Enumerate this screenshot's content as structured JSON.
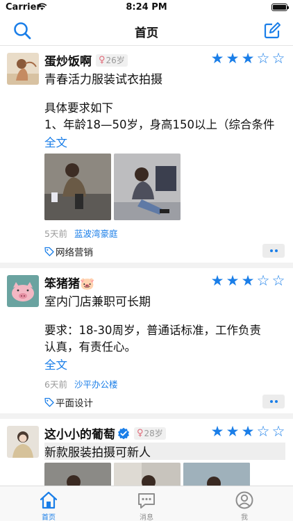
{
  "status_bar": {
    "carrier": "Carrier",
    "time": "8:24 PM"
  },
  "nav": {
    "title": "首页"
  },
  "posts": [
    {
      "username": "蛋炒饭啊",
      "age": "26岁",
      "rating": 3,
      "max_rating": 5,
      "title": "青春活力服装试衣拍摄",
      "body": "具体要求如下\n1、年龄18—50岁，身高150以上（综合条件",
      "more_text": "全文",
      "time": "5天前",
      "place": "蓝波湾豪庭",
      "tag": "网络营销"
    },
    {
      "username": "笨猪猪🐷",
      "rating": 3,
      "max_rating": 5,
      "title": "室内门店兼职可长期",
      "body": "要求：18-30周岁，普通话标准，工作负责\n认真，有责任心。",
      "more_text": "全文",
      "time": "6天前",
      "place": "沙平办公楼",
      "tag": "平面设计"
    },
    {
      "username": "这小小的葡萄",
      "age": "28岁",
      "rating": 3,
      "max_rating": 5,
      "title": "新款服装拍摄可新人"
    }
  ],
  "tabs": [
    {
      "label": "首页",
      "icon": "home-icon"
    },
    {
      "label": "消息",
      "icon": "message-icon"
    },
    {
      "label": "我",
      "icon": "person-icon"
    }
  ],
  "colors": {
    "accent": "#1a7ee8",
    "female": "#e06a78",
    "separator": "#f2f2f2"
  }
}
